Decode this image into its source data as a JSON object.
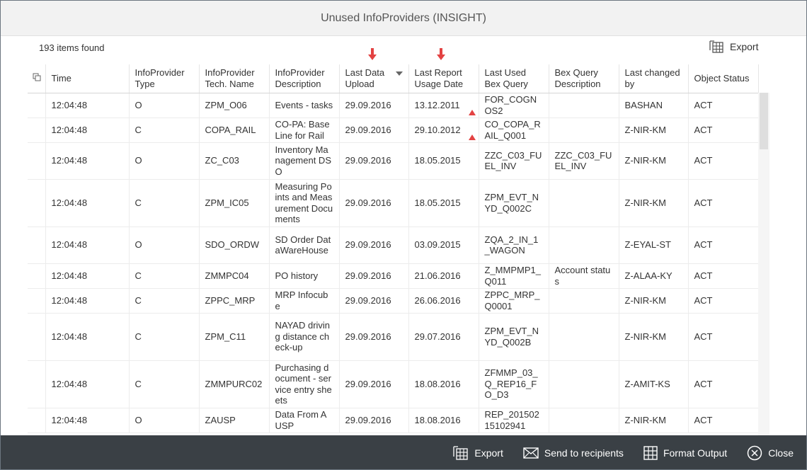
{
  "dialog": {
    "title": "Unused InfoProviders (INSIGHT)"
  },
  "toolbar": {
    "items_found": "193 items found",
    "export_label": "Export"
  },
  "columns": [
    "Time",
    "InfoProvider Type",
    "InfoProvider Tech. Name",
    "InfoProvider Description",
    "Last Data Upload",
    "Last Report Usage Date",
    "Last Used Bex Query",
    "Bex Query Description",
    "Last changed by",
    "Object Status"
  ],
  "rows": [
    {
      "time": "12:04:48",
      "type": "O",
      "tech": "ZPM_O06",
      "desc": "Events - tasks",
      "upload": "29.09.2016",
      "usage": "13.12.2011",
      "usage_warn": true,
      "query": "FOR_COGNOS2",
      "qdesc": "",
      "changed": "BASHAN",
      "status": "ACT"
    },
    {
      "time": "12:04:48",
      "type": "C",
      "tech": "COPA_RAIL",
      "desc": "CO-PA: Base Line for Rail",
      "upload": "29.09.2016",
      "usage": "29.10.2012",
      "usage_warn": true,
      "query": "CO_COPA_RAIL_Q001",
      "qdesc": "",
      "changed": "Z-NIR-KM",
      "status": "ACT"
    },
    {
      "time": "12:04:48",
      "type": "O",
      "tech": "ZC_C03",
      "desc": "Inventory Management DSO",
      "upload": "29.09.2016",
      "usage": "18.05.2015",
      "usage_warn": false,
      "query": "ZZC_C03_FUEL_INV",
      "qdesc": "ZZC_C03_FUEL_INV",
      "changed": "Z-NIR-KM",
      "status": "ACT"
    },
    {
      "time": "12:04:48",
      "type": "C",
      "tech": "ZPM_IC05",
      "desc": "Measuring Points and Measurement Documents",
      "upload": "29.09.2016",
      "usage": "18.05.2015",
      "usage_warn": false,
      "query": "ZPM_EVT_NYD_Q002C",
      "qdesc": "",
      "changed": "Z-NIR-KM",
      "status": "ACT"
    },
    {
      "time": "12:04:48",
      "type": "O",
      "tech": "SDO_ORDW",
      "desc": "SD Order DataWareHouse",
      "upload": "29.09.2016",
      "usage": "03.09.2015",
      "usage_warn": false,
      "query": "ZQA_2_IN_1_WAGON",
      "qdesc": "",
      "changed": "Z-EYAL-ST",
      "status": "ACT"
    },
    {
      "time": "12:04:48",
      "type": "C",
      "tech": "ZMMPC04",
      "desc": "PO history",
      "upload": "29.09.2016",
      "usage": "21.06.2016",
      "usage_warn": false,
      "query": "Z_MMPMP1_Q011",
      "qdesc": "Account status",
      "changed": "Z-ALAA-KY",
      "status": "ACT"
    },
    {
      "time": "12:04:48",
      "type": "C",
      "tech": "ZPPC_MRP",
      "desc": "MRP Infocube",
      "upload": "29.09.2016",
      "usage": "26.06.2016",
      "usage_warn": false,
      "query": "ZPPC_MRP_Q0001",
      "qdesc": "",
      "changed": "Z-NIR-KM",
      "status": "ACT"
    },
    {
      "time": "12:04:48",
      "type": "C",
      "tech": "ZPM_C11",
      "desc": "NAYAD driving distance check-up",
      "upload": "29.09.2016",
      "usage": "29.07.2016",
      "usage_warn": false,
      "query": "ZPM_EVT_NYD_Q002B",
      "qdesc": "",
      "changed": "Z-NIR-KM",
      "status": "ACT"
    },
    {
      "time": "12:04:48",
      "type": "C",
      "tech": "ZMMPURC02",
      "desc": "Purchasing document - service entry sheets",
      "upload": "29.09.2016",
      "usage": "18.08.2016",
      "usage_warn": false,
      "query": "ZFMMP_03_Q_REP16_FO_D3",
      "qdesc": "",
      "changed": "Z-AMIT-KS",
      "status": "ACT"
    },
    {
      "time": "12:04:48",
      "type": "O",
      "tech": "ZAUSP",
      "desc": "Data From AUSP",
      "upload": "29.09.2016",
      "usage": "18.08.2016",
      "usage_warn": false,
      "query": "REP_20150215102941",
      "qdesc": "",
      "changed": "Z-NIR-KM",
      "status": "ACT"
    }
  ],
  "footer": {
    "export_label": "Export",
    "send_label": "Send to recipients",
    "format_label": "Format Output",
    "close_label": "Close"
  },
  "colors": {
    "footer_bg": "#3a4045",
    "arrow": "#e34242",
    "warning": "#e34242"
  },
  "icons": [
    "export-icon",
    "envelope-icon",
    "grid-icon",
    "close-circle-icon",
    "filter-icon",
    "warning-icon",
    "copy-icon",
    "down-arrow-icon"
  ]
}
